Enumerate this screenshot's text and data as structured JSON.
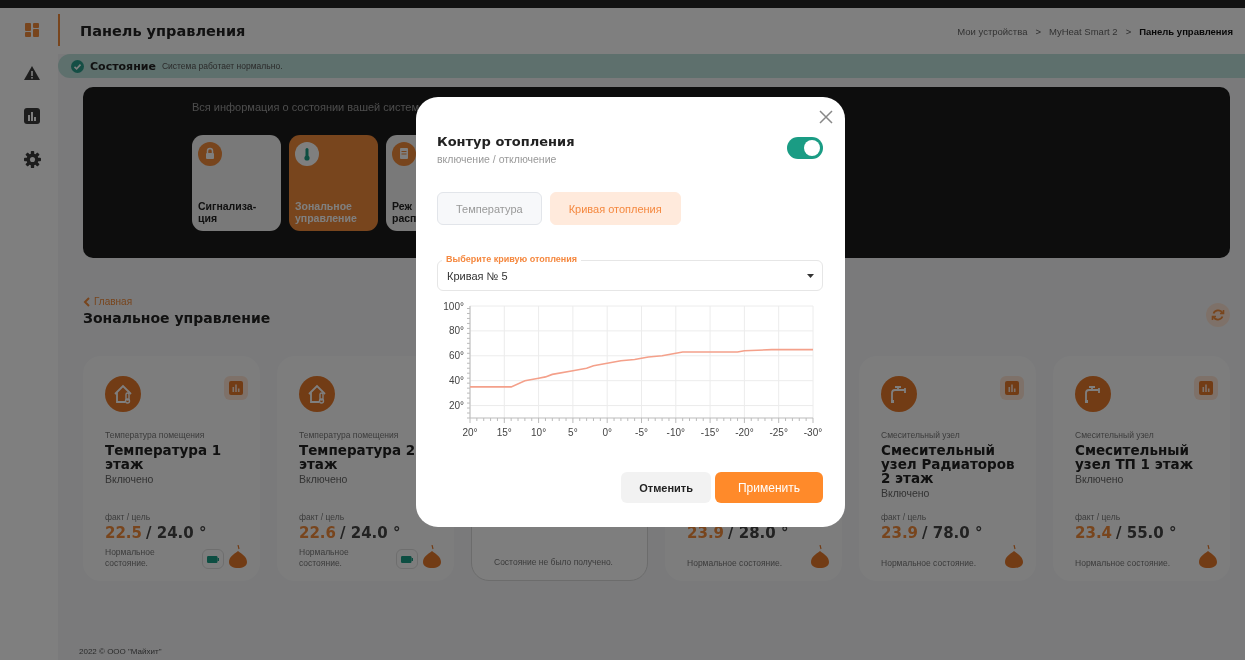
{
  "window": {
    "title": "Панель управления"
  },
  "sidebar": {
    "items": [
      {
        "kind": "dashboard",
        "selected": true
      },
      {
        "kind": "alerts",
        "selected": false
      },
      {
        "kind": "stats",
        "selected": false
      },
      {
        "kind": "settings",
        "selected": false
      }
    ]
  },
  "breadcrumbs": [
    {
      "kind": "link",
      "label": "Мои устройства",
      "current": false
    },
    {
      "kind": "separator",
      "label": ">"
    },
    {
      "kind": "link",
      "label": "MyHeat Smart 2",
      "current": false
    },
    {
      "kind": "separator",
      "label": ">"
    },
    {
      "kind": "link",
      "label": "Панель управления",
      "current": true
    }
  ],
  "status": {
    "label": "Состояние",
    "message": "Система работает нормально."
  },
  "banner": {
    "text": "Вся информация о состоянии вашей систем",
    "tiles": [
      {
        "kind": "lock",
        "lines": [
          "Сигнализа-",
          "ция"
        ],
        "selected": false
      },
      {
        "kind": "thermometer",
        "lines": [
          "Зональное",
          "управление"
        ],
        "selected": true
      },
      {
        "kind": "document",
        "lines": [
          "Реж",
          "расп"
        ],
        "selected": false
      }
    ]
  },
  "section": {
    "back_link": "Главная",
    "title": "Зональное управление"
  },
  "cards": [
    {
      "kind": "room",
      "available": true,
      "category": "Температура помещения",
      "title": "Температура 1 этаж",
      "state": "Включено",
      "fact_label": "факт / цель",
      "fact": "22.5",
      "target": "/ 24.0 °",
      "status": "Нормальное состояние.",
      "battery": true
    },
    {
      "kind": "room",
      "available": true,
      "category": "Температура помещения",
      "title": "Температура 2 этаж",
      "state": "Включено",
      "fact_label": "факт / цель",
      "fact": "22.6",
      "target": "/ 24.0 °",
      "status": "Нормальное состояние.",
      "battery": true
    },
    {
      "available": false,
      "status": "Состояние не было получено.",
      "battery": false
    },
    {
      "available": true,
      "fact": "23.9",
      "target": "/ 28.0 °",
      "status": "Нормальное состояние.",
      "battery": false
    },
    {
      "kind": "mixer",
      "available": true,
      "category": "Смесительный узел",
      "title": "Смесительный узел Радиаторов 2 этаж",
      "state": "Включено",
      "fact_label": "факт / цель",
      "fact": "23.9",
      "target": "/ 78.0 °",
      "status": "Нормальное состояние.",
      "battery": false
    },
    {
      "kind": "mixer",
      "available": true,
      "category": "Смесительный узел",
      "title": "Смесительный узел ТП 1 этаж",
      "state": "Включено",
      "fact_label": "факт / цель",
      "fact": "23.4",
      "target": "/ 55.0 °",
      "status": "Нормальное состояние.",
      "battery": false
    }
  ],
  "footer": "2022 © ООО \"Майхит\"",
  "dialog": {
    "title": "Контур отопления",
    "subtitle": "включение / отключение",
    "enabled": true,
    "tabs": [
      {
        "label": "Температура",
        "selected": false
      },
      {
        "label": "Кривая отопления",
        "selected": true
      }
    ],
    "curve_select": {
      "label": "Выберите кривую отопления",
      "value": "Кривая № 5"
    },
    "chart_data": {
      "type": "line",
      "grid": true,
      "xlim": [
        20,
        -30
      ],
      "ylim": [
        10,
        100
      ],
      "xticks": [
        {
          "value": 20,
          "label": "20°"
        },
        {
          "value": 15,
          "label": "15°"
        },
        {
          "value": 10,
          "label": "10°"
        },
        {
          "value": 5,
          "label": "5°"
        },
        {
          "value": 0,
          "label": "0°"
        },
        {
          "value": -5,
          "label": "-5°"
        },
        {
          "value": -10,
          "label": "-10°"
        },
        {
          "value": -15,
          "label": "-15°"
        },
        {
          "value": -20,
          "label": "-20°"
        },
        {
          "value": -25,
          "label": "-25°"
        },
        {
          "value": -30,
          "label": "-30°"
        }
      ],
      "yticks": [
        {
          "value": 20,
          "label": "20°"
        },
        {
          "value": 40,
          "label": "40°"
        },
        {
          "value": 60,
          "label": "60°"
        },
        {
          "value": 80,
          "label": "80°"
        },
        {
          "value": 100,
          "label": "100°"
        }
      ],
      "x": [
        20,
        14,
        12,
        10,
        9,
        8,
        5,
        3,
        2,
        0,
        -2,
        -4,
        -6,
        -8,
        -11,
        -19,
        -20,
        -24,
        -30
      ],
      "series": [
        {
          "color": "#f4a08a",
          "values": [
            35,
            35,
            40,
            42,
            43,
            45,
            48,
            50,
            52,
            54,
            56,
            57,
            59,
            60,
            63,
            63,
            64,
            65,
            65
          ]
        }
      ]
    },
    "buttons": [
      {
        "kind": "secondary",
        "label": "Отменить"
      },
      {
        "kind": "primary",
        "label": "Применить"
      }
    ]
  }
}
